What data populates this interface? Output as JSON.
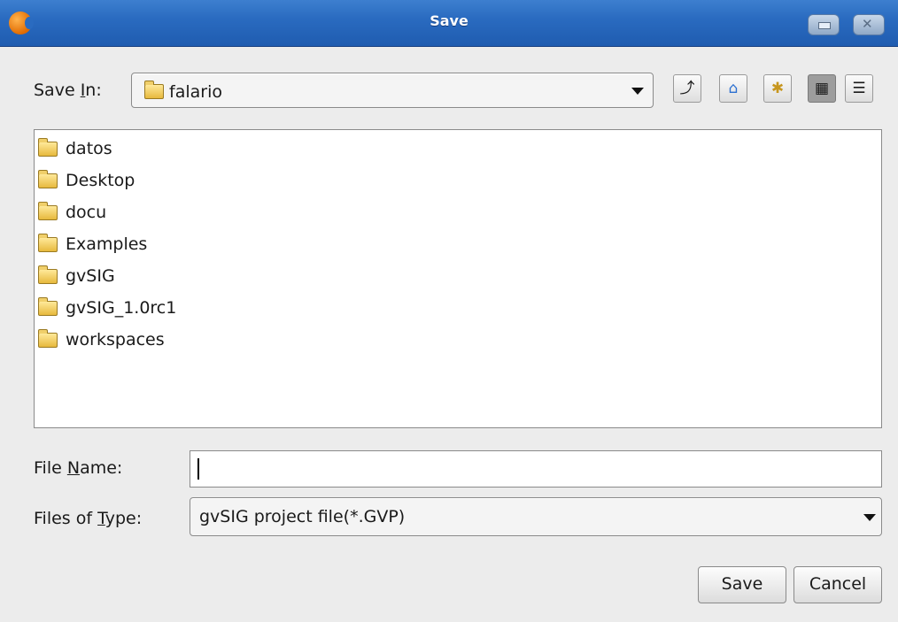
{
  "window": {
    "title": "Save"
  },
  "save_in": {
    "label": "Save In:",
    "value": "falario"
  },
  "toolbar": {
    "icons": [
      "up-one-level-icon",
      "home-icon",
      "new-folder-icon",
      "list-view-icon",
      "details-view-icon"
    ]
  },
  "files": [
    {
      "name": "datos"
    },
    {
      "name": "Desktop"
    },
    {
      "name": "docu"
    },
    {
      "name": "Examples"
    },
    {
      "name": "gvSIG"
    },
    {
      "name": "gvSIG_1.0rc1"
    },
    {
      "name": "workspaces"
    }
  ],
  "file_name": {
    "label": "File Name:",
    "value": ""
  },
  "file_type": {
    "label": "Files of Type:",
    "value": "gvSIG project file(*.GVP)"
  },
  "buttons": {
    "save": "Save",
    "cancel": "Cancel"
  },
  "colors": {
    "titlebar": "#2a6bc0",
    "background": "#ececec"
  }
}
